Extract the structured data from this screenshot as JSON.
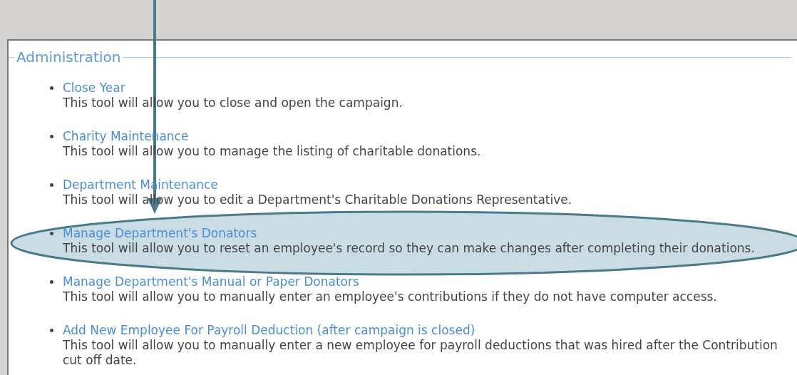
{
  "section": {
    "title": "Administration"
  },
  "tools": [
    {
      "link": "Close Year",
      "description": "This tool will allow you to close and open the campaign.",
      "highlighted": false
    },
    {
      "link": "Charity Maintenance",
      "description": "This tool will allow you to manage the listing of charitable donations.",
      "highlighted": false
    },
    {
      "link": "Department Maintenance",
      "description": "This tool will allow you to edit a Department's Charitable Donations Representative.",
      "highlighted": false
    },
    {
      "link": "Manage Department's Donators",
      "description": "This tool will allow you to reset an employee's record so they can make changes after completing their donations.",
      "highlighted": true
    },
    {
      "link": "Manage Department's Manual or Paper Donators",
      "description": "This tool will allow you to manually enter an employee's contributions if they do not have computer access.",
      "highlighted": false
    },
    {
      "link": "Add New Employee For Payroll Deduction (after campaign is closed)",
      "description": "This tool will allow you to manually enter a new employee for payroll deductions that was hired after the Contribution cut off date.",
      "highlighted": false
    }
  ]
}
